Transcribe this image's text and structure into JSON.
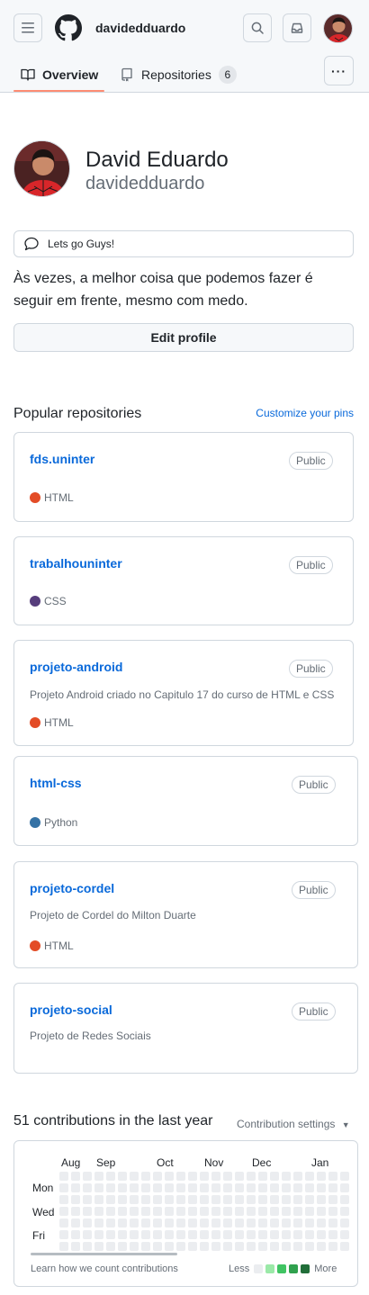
{
  "header": {
    "menu_icon": "hamburger-icon",
    "logo_icon": "github-mark-icon",
    "username": "davidedduardo",
    "search_icon": "search-icon",
    "inbox_icon": "inbox-icon"
  },
  "tabs": {
    "overview": "Overview",
    "repositories": "Repositories",
    "repositories_count": "6",
    "more": "···"
  },
  "profile": {
    "display_name": "David Eduardo",
    "login": "davidedduardo",
    "status": "Lets go Guys!",
    "bio": "Às vezes, a melhor coisa que podemos fazer é seguir em frente, mesmo com medo.",
    "edit_button": "Edit profile"
  },
  "pinned": {
    "title": "Popular repositories",
    "customize": "Customize your pins",
    "repos": [
      {
        "name": "fds.uninter",
        "visibility": "Public",
        "description": "",
        "language": "HTML",
        "lang_color": "#e34c26"
      },
      {
        "name": "trabalhouninter",
        "visibility": "Public",
        "description": "",
        "language": "CSS",
        "lang_color": "#563d7c"
      },
      {
        "name": "projeto-android",
        "visibility": "Public",
        "description": "Projeto Android criado no Capitulo 17 do curso de HTML e CSS",
        "language": "HTML",
        "lang_color": "#e34c26"
      },
      {
        "name": "html-css",
        "visibility": "Public",
        "description": "",
        "language": "Python",
        "lang_color": "#3572a5"
      },
      {
        "name": "projeto-cordel",
        "visibility": "Public",
        "description": "Projeto de Cordel do Milton Duarte",
        "language": "HTML",
        "lang_color": "#e34c26"
      },
      {
        "name": "projeto-social",
        "visibility": "Public",
        "description": "Projeto de Redes Sociais",
        "language": "",
        "lang_color": ""
      }
    ]
  },
  "contributions": {
    "title": "51 contributions in the last year",
    "settings": "Contribution settings",
    "months": [
      "Aug",
      "Sep",
      "Oct",
      "Nov",
      "Dec",
      "Jan"
    ],
    "days": [
      "Mon",
      "Wed",
      "Fri"
    ],
    "learn": "Learn how we count contributions",
    "legend_less": "Less",
    "legend_more": "More",
    "legend_colors": [
      "#ebedf0",
      "#9be9a8",
      "#40c463",
      "#30a14e",
      "#216e39"
    ]
  }
}
